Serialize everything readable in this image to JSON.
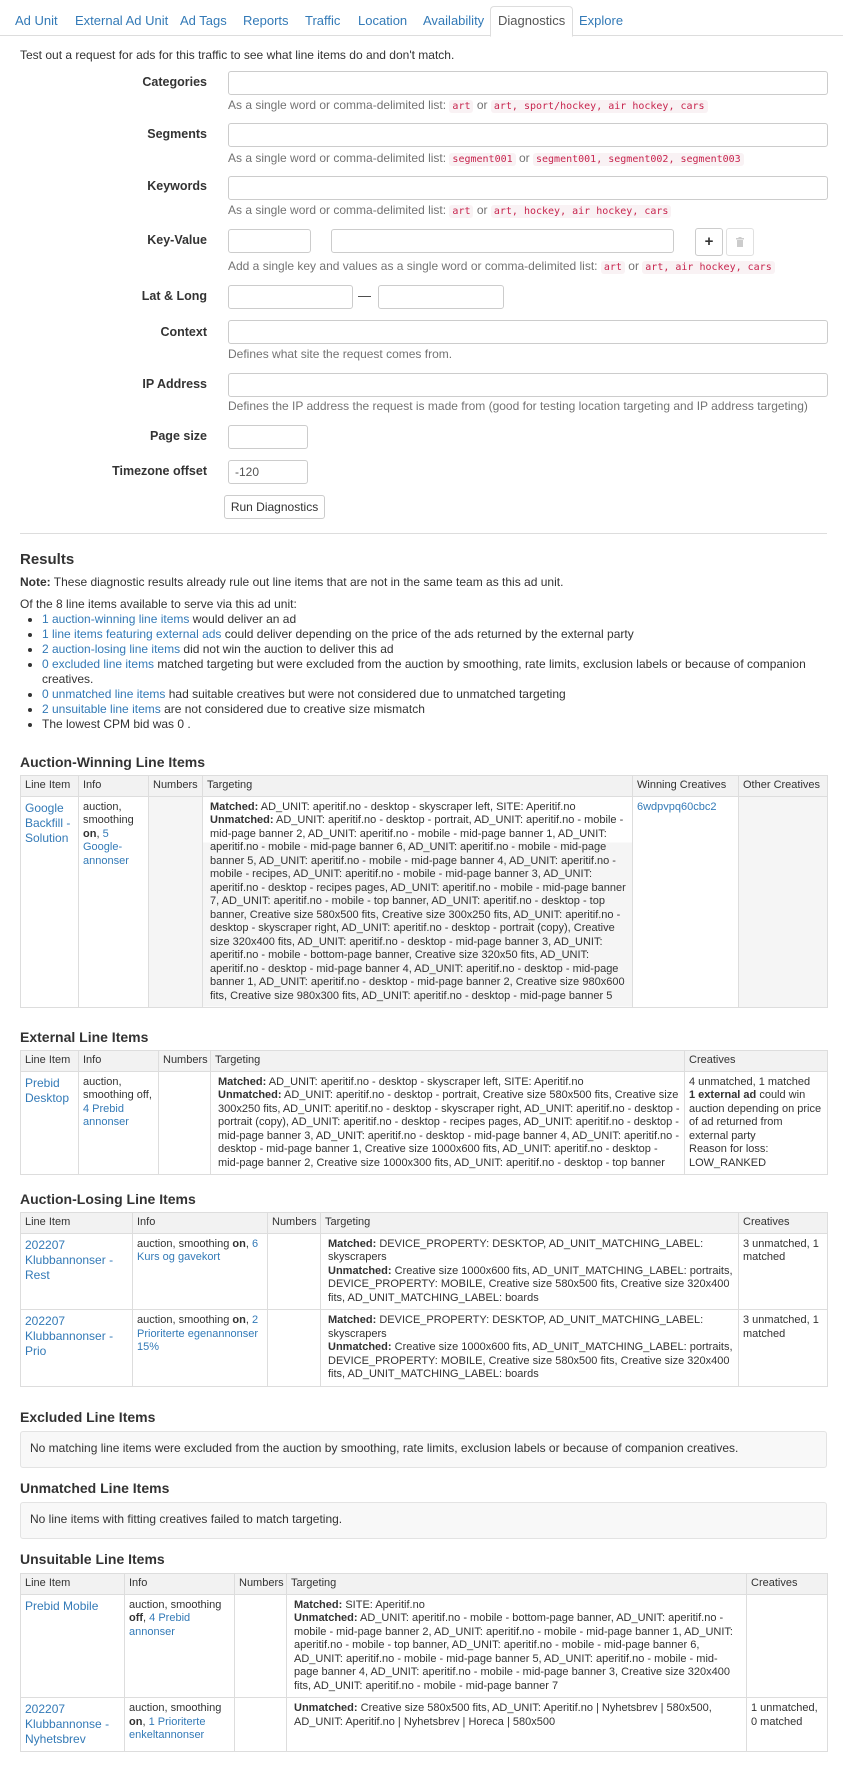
{
  "tabs": [
    {
      "label": "Ad Unit",
      "active": false
    },
    {
      "label": "External Ad Unit",
      "active": false
    },
    {
      "label": "Ad Tags",
      "active": false
    },
    {
      "label": "Reports",
      "active": false
    },
    {
      "label": "Traffic",
      "active": false
    },
    {
      "label": "Location",
      "active": false
    },
    {
      "label": "Availability",
      "active": false
    },
    {
      "label": "Diagnostics",
      "active": true
    },
    {
      "label": "Explore",
      "active": false
    }
  ],
  "intro": "Test out a request for ads for this traffic to see what line items do and don't match.",
  "form": {
    "categories": {
      "label": "Categories",
      "help_prefix": "As a single word or comma-delimited list:",
      "ex1": "art",
      "or": "or",
      "ex2": "art, sport/hockey, air hockey, cars"
    },
    "segments": {
      "label": "Segments",
      "help_prefix": "As a single word or comma-delimited list:",
      "ex1": "segment001",
      "or": "or",
      "ex2": "segment001, segment002, segment003"
    },
    "keywords": {
      "label": "Keywords",
      "help_prefix": "As a single word or comma-delimited list:",
      "ex1": "art",
      "or": "or",
      "ex2": "art, hockey, air hockey, cars"
    },
    "key_value": {
      "label": "Key-Value",
      "add_button": "+",
      "help_prefix": "Add a single key and values as a single word or comma-delimited list:",
      "ex1": "art",
      "or": "or",
      "ex2": "art, air hockey, cars"
    },
    "lat_long": {
      "label": "Lat & Long",
      "separator": "—"
    },
    "context": {
      "label": "Context",
      "help": "Defines what site the request comes from."
    },
    "ip": {
      "label": "IP Address",
      "help": "Defines the IP address the request is made from (good for testing location targeting and IP address targeting)"
    },
    "page_size": {
      "label": "Page size",
      "value": ""
    },
    "timezone": {
      "label": "Timezone offset",
      "value": "-120"
    },
    "run_button": "Run Diagnostics"
  },
  "results": {
    "heading": "Results",
    "note_bold": "Note:",
    "note": "These diagnostic results already rule out line items that are not in the same team as this ad unit.",
    "summary": "Of the 8 line items available to serve via this ad unit:",
    "items": [
      {
        "link": "1 auction-winning line items",
        "text": " would deliver an ad"
      },
      {
        "link": "1 line items featuring external ads",
        "text": " could deliver depending on the price of the ads returned by the external party"
      },
      {
        "link": "2 auction-losing line items",
        "text": " did not win the auction to deliver this ad"
      },
      {
        "link": "0 excluded line items",
        "text": " matched targeting but were excluded from the auction by smoothing, rate limits, exclusion labels or because of companion creatives."
      },
      {
        "link": "0 unmatched line items",
        "text": " had suitable creatives but were not considered due to unmatched targeting"
      },
      {
        "link": "2 unsuitable line items",
        "text": " are not considered due to creative size mismatch"
      },
      {
        "link": "",
        "text": "The lowest CPM bid was 0 ."
      }
    ]
  },
  "cols": {
    "line_item": "Line Item",
    "info": "Info",
    "numbers": "Numbers",
    "targeting": "Targeting",
    "winning_creatives": "Winning Creatives",
    "other_creatives": "Other Creatives",
    "creatives": "Creatives",
    "matched": "Matched:",
    "unmatched": "Unmatched:"
  },
  "winning": {
    "heading": "Auction-Winning Line Items",
    "rows": [
      {
        "name": "Google Backfill - Solution",
        "info_a": "auction, smoothing ",
        "info_b": "on",
        "info_c": ", ",
        "info_link": "5 Google-annonser",
        "matched": "AD_UNIT: aperitif.no - desktop - skyscraper left, SITE: Aperitif.no",
        "unmatched": "AD_UNIT: aperitif.no - desktop - portrait, AD_UNIT: aperitif.no - mobile - mid-page banner 2, AD_UNIT: aperitif.no - mobile - mid-page banner 1, AD_UNIT: aperitif.no - mobile - mid-page banner 6, AD_UNIT: aperitif.no - mobile - mid-page banner 5, AD_UNIT: aperitif.no - mobile - mid-page banner 4, AD_UNIT: aperitif.no - mobile - recipes, AD_UNIT: aperitif.no - mobile - mid-page banner 3, AD_UNIT: aperitif.no - desktop - recipes pages, AD_UNIT: aperitif.no - mobile - mid-page banner 7, AD_UNIT: aperitif.no - mobile - top banner, AD_UNIT: aperitif.no - desktop - top banner, Creative size 580x500 fits, Creative size 300x250 fits, AD_UNIT: aperitif.no - desktop - skyscraper right, AD_UNIT: aperitif.no - desktop - portrait (copy), Creative size 320x400 fits, AD_UNIT: aperitif.no - desktop - mid-page banner 3, AD_UNIT: aperitif.no - mobile - bottom-page banner, Creative size 320x50 fits, AD_UNIT: aperitif.no - desktop - mid-page banner 4, AD_UNIT: aperitif.no - desktop - mid-page banner 1, AD_UNIT: aperitif.no - desktop - mid-page banner 2, Creative size 980x600 fits, Creative size 980x300 fits, AD_UNIT: aperitif.no - desktop - mid-page banner 5",
        "winning_creative": "6wdpvpq60cbc2"
      }
    ]
  },
  "external": {
    "heading": "External Line Items",
    "rows": [
      {
        "name": "Prebid Desktop",
        "info_a": "auction, smoothing off, ",
        "info_link": "4 Prebid annonser",
        "matched": "AD_UNIT: aperitif.no - desktop - skyscraper left, SITE: Aperitif.no",
        "unmatched": "AD_UNIT: aperitif.no - desktop - portrait, Creative size 580x500 fits, Creative size 300x250 fits, AD_UNIT: aperitif.no - desktop - skyscraper right, AD_UNIT: aperitif.no - desktop - portrait (copy), AD_UNIT: aperitif.no - desktop - recipes pages, AD_UNIT: aperitif.no - desktop - mid-page banner 3, AD_UNIT: aperitif.no - desktop - mid-page banner 4, AD_UNIT: aperitif.no - desktop - mid-page banner 1, Creative size 1000x600 fits, AD_UNIT: aperitif.no - desktop - mid-page banner 2, Creative size 1000x300 fits, AD_UNIT: aperitif.no - desktop - top banner",
        "cr_line1": "4 unmatched, 1 matched",
        "cr_bold": "1 external ad",
        "cr_rest": " could win auction depending on price of ad returned from external party",
        "cr_reason": "Reason for loss: LOW_RANKED"
      }
    ]
  },
  "losing": {
    "heading": "Auction-Losing Line Items",
    "rows": [
      {
        "name": "202207 Klubbannonser - Rest",
        "info_a": "auction, smoothing ",
        "info_b": "on",
        "info_c": ", ",
        "info_link": "6 Kurs og gavekort",
        "matched": "DEVICE_PROPERTY: DESKTOP, AD_UNIT_MATCHING_LABEL: skyscrapers",
        "unmatched": "Creative size 1000x600 fits, AD_UNIT_MATCHING_LABEL: portraits, DEVICE_PROPERTY: MOBILE, Creative size 580x500 fits, Creative size 320x400 fits, AD_UNIT_MATCHING_LABEL: boards",
        "creatives": "3 unmatched, 1 matched"
      },
      {
        "name": "202207 Klubbannonser - Prio",
        "info_a": "auction, smoothing ",
        "info_b": "on",
        "info_c": ", ",
        "info_link": "2 Prioriterte egenannonser 15%",
        "matched": "DEVICE_PROPERTY: DESKTOP, AD_UNIT_MATCHING_LABEL: skyscrapers",
        "unmatched": "Creative size 1000x600 fits, AD_UNIT_MATCHING_LABEL: portraits, DEVICE_PROPERTY: MOBILE, Creative size 580x500 fits, Creative size 320x400 fits, AD_UNIT_MATCHING_LABEL: boards",
        "creatives": "3 unmatched, 1 matched"
      }
    ]
  },
  "excluded": {
    "heading": "Excluded Line Items",
    "message": "No matching line items were excluded from the auction by smoothing, rate limits, exclusion labels or because of companion creatives."
  },
  "unmatched_section": {
    "heading": "Unmatched Line Items",
    "message": "No line items with fitting creatives failed to match targeting."
  },
  "unsuitable": {
    "heading": "Unsuitable Line Items",
    "rows": [
      {
        "name": "Prebid Mobile",
        "info_a": "auction, smoothing ",
        "info_b": "off",
        "info_c": ", ",
        "info_link": "4 Prebid annonser",
        "matched": "SITE: Aperitif.no",
        "unmatched": "AD_UNIT: aperitif.no - mobile - bottom-page banner, AD_UNIT: aperitif.no - mobile - mid-page banner 2, AD_UNIT: aperitif.no - mobile - mid-page banner 1, AD_UNIT: aperitif.no - mobile - top banner, AD_UNIT: aperitif.no - mobile - mid-page banner 6, AD_UNIT: aperitif.no - mobile - mid-page banner 5, AD_UNIT: aperitif.no - mobile - mid-page banner 4, AD_UNIT: aperitif.no - mobile - mid-page banner 3, Creative size 320x400 fits, AD_UNIT: aperitif.no - mobile - mid-page banner 7",
        "creatives": ""
      },
      {
        "name": "202207 Klubbannonse - Nyhetsbrev",
        "info_a": "auction, smoothing ",
        "info_b": "on",
        "info_c": ", ",
        "info_link": "1 Prioriterte enkeltannonser",
        "matched": "",
        "unmatched": "Creative size 580x500 fits, AD_UNIT: Aperitif.no | Nyhetsbrev | 580x500, AD_UNIT: Aperitif.no | Nyhetsbrev | Horeca | 580x500",
        "creatives": "1 unmatched, 0 matched"
      }
    ]
  }
}
